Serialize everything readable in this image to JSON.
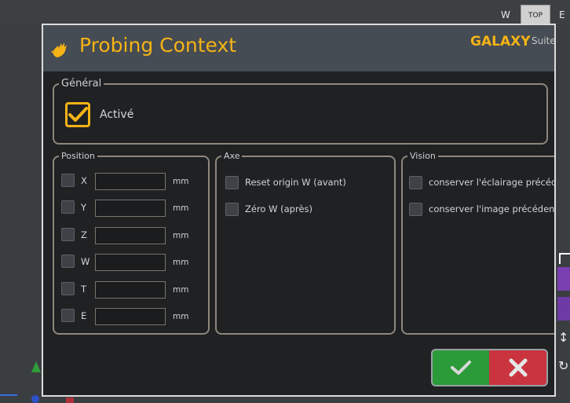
{
  "viewcube": {
    "w": "W",
    "top": "TOP",
    "e": "E"
  },
  "dialog": {
    "title": "Probing Context",
    "brand": "GALAXY",
    "brand_suite": "Suite"
  },
  "general": {
    "legend": "Général",
    "active_label": "Activé",
    "active_checked": true
  },
  "position": {
    "legend": "Position",
    "rows": [
      {
        "axis": "X",
        "value": "",
        "unit": "mm",
        "checked": false
      },
      {
        "axis": "Y",
        "value": "",
        "unit": "mm",
        "checked": false
      },
      {
        "axis": "Z",
        "value": "",
        "unit": "mm",
        "checked": false
      },
      {
        "axis": "W",
        "value": "",
        "unit": "mm",
        "checked": false
      },
      {
        "axis": "T",
        "value": "",
        "unit": "mm",
        "checked": false
      },
      {
        "axis": "E",
        "value": "",
        "unit": "mm",
        "checked": false
      }
    ]
  },
  "axe": {
    "legend": "Axe",
    "options": [
      {
        "label": "Reset origin W (avant)",
        "checked": false
      },
      {
        "label": "Zéro W (après)",
        "checked": false
      }
    ]
  },
  "vision": {
    "legend": "Vision",
    "options": [
      {
        "label": "conserver l'éclairage précédent",
        "checked": false
      },
      {
        "label": "conserver l'image précédente",
        "checked": false
      }
    ]
  },
  "colors": {
    "accent": "#f5b316",
    "ok": "#2b9a39",
    "cancel": "#c9343f",
    "header": "#454c53",
    "panel": "#1f2123"
  },
  "icons": {
    "logo": "hand-probe-icon",
    "ok": "checkmark-icon",
    "cancel": "cross-icon"
  }
}
